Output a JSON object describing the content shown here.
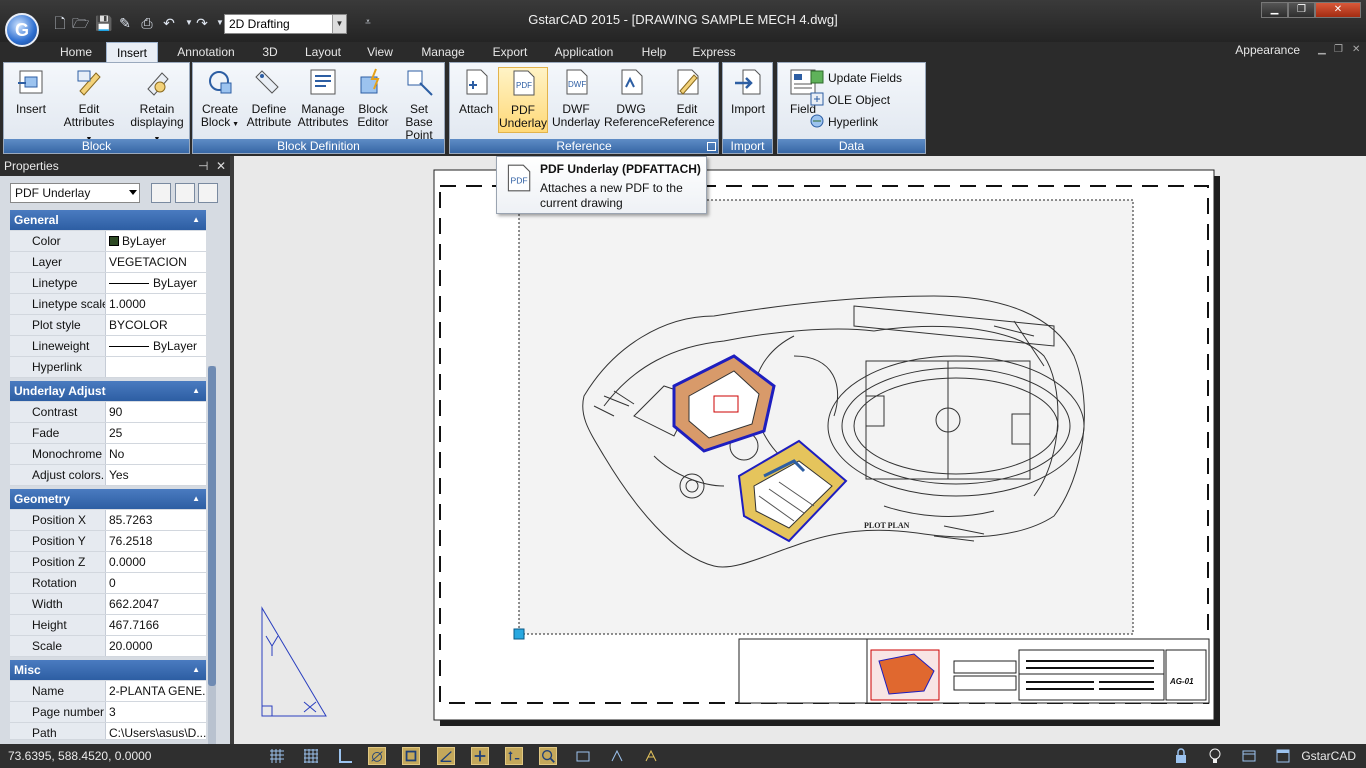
{
  "window": {
    "title": "GstarCAD 2015 - [DRAWING SAMPLE MECH 4.dwg]",
    "workspace": "2D Drafting"
  },
  "tabs": [
    "Home",
    "Insert",
    "Annotation",
    "3D",
    "Layout",
    "View",
    "Manage",
    "Export",
    "Application",
    "Help",
    "Express"
  ],
  "active_tab": "Insert",
  "appearance_label": "Appearance",
  "ribbon": {
    "block": {
      "title": "Block",
      "insert": "Insert",
      "edit_attributes_1": "Edit",
      "edit_attributes_2": "Attributes",
      "retain_1": "Retain",
      "retain_2": "displaying"
    },
    "block_definition": {
      "title": "Block Definition",
      "create_1": "Create",
      "create_2": "Block",
      "define_1": "Define",
      "define_2": "Attribute",
      "manage_1": "Manage",
      "manage_2": "Attributes",
      "editor_1": "Block",
      "editor_2": "Editor",
      "basepoint_1": "Set Base",
      "basepoint_2": "Point"
    },
    "reference": {
      "title": "Reference",
      "attach": "Attach",
      "pdf_1": "PDF",
      "pdf_2": "Underlay",
      "dwf_1": "DWF",
      "dwf_2": "Underlay",
      "dwg_1": "DWG",
      "dwg_2": "Reference",
      "editref_1": "Edit",
      "editref_2": "Reference"
    },
    "import": {
      "title": "Import",
      "import": "Import"
    },
    "data": {
      "title": "Data",
      "field": "Field",
      "update_fields": "Update Fields",
      "ole_object": "OLE Object",
      "hyperlink": "Hyperlink"
    }
  },
  "tooltip": {
    "title": "PDF Underlay (PDFATTACH)",
    "description": "Attaches a new PDF to the current drawing"
  },
  "properties": {
    "header": "Properties",
    "selection": "PDF Underlay",
    "general": {
      "title": "General",
      "color_k": "Color",
      "color_v": "ByLayer",
      "layer_k": "Layer",
      "layer_v": "VEGETACION",
      "linetype_k": "Linetype",
      "linetype_v": "ByLayer",
      "ltscale_k": "Linetype scale",
      "ltscale_v": "1.0000",
      "plotstyle_k": "Plot style",
      "plotstyle_v": "BYCOLOR",
      "lineweight_k": "Lineweight",
      "lineweight_v": "ByLayer",
      "hyperlink_k": "Hyperlink",
      "hyperlink_v": ""
    },
    "underlay": {
      "title": "Underlay Adjust",
      "contrast_k": "Contrast",
      "contrast_v": "90",
      "fade_k": "Fade",
      "fade_v": "25",
      "mono_k": "Monochrome",
      "mono_v": "No",
      "adjust_k": "Adjust colors...",
      "adjust_v": "Yes"
    },
    "geometry": {
      "title": "Geometry",
      "px_k": "Position X",
      "px_v": "85.7263",
      "py_k": "Position Y",
      "py_v": "76.2518",
      "pz_k": "Position Z",
      "pz_v": "0.0000",
      "rot_k": "Rotation",
      "rot_v": "0",
      "w_k": "Width",
      "w_v": "662.2047",
      "h_k": "Height",
      "h_v": "467.7166",
      "scale_k": "Scale",
      "scale_v": "20.0000"
    },
    "misc": {
      "title": "Misc",
      "name_k": "Name",
      "name_v": "2-PLANTA GENE...",
      "page_k": "Page number",
      "page_v": "3",
      "path_k": "Path",
      "path_v": "C:\\Users\\asus\\D..."
    }
  },
  "drawing": {
    "plot_plan_label": "PLOT PLAN",
    "sheet_id": "AG-01"
  },
  "status": {
    "coordinates": "73.6395, 588.4520, 0.0000",
    "brand": "GstarCAD"
  }
}
